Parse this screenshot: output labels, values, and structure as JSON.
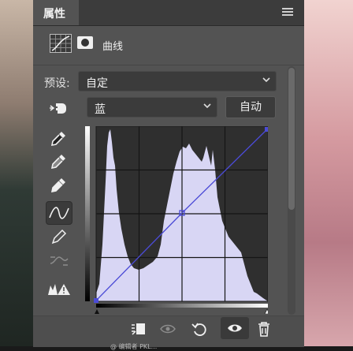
{
  "panel": {
    "tab_label": "属性",
    "adjustment_label": "曲线",
    "preset_label": "预设:",
    "preset_value": "自定",
    "channel_value": "蓝",
    "auto_button": "自动"
  },
  "curve": {
    "channel_color": "#4b4bd6",
    "histogram_color": "#d8d6f4",
    "points": [
      [
        0,
        0
      ],
      [
        100,
        112
      ],
      [
        255,
        255
      ]
    ]
  },
  "footer": {
    "watermark": "@ 编辑者 PKL..."
  },
  "icons": [
    "menu-icon",
    "curves-adjustment-icon",
    "layer-mask-icon",
    "hand-target-icon",
    "eyedropper-black-icon",
    "eyedropper-gray-icon",
    "eyedropper-white-icon",
    "curve-point-tool-icon",
    "pencil-icon",
    "smooth-curve-icon",
    "clipping-warning-icon",
    "clip-to-layer-icon",
    "view-previous-icon",
    "reset-icon",
    "visibility-eye-icon",
    "trash-icon"
  ]
}
